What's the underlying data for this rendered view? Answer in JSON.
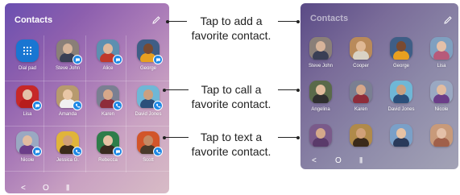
{
  "left_screen": {
    "title": "Contacts",
    "contacts": [
      {
        "name": "Dial pad",
        "type": "dialpad",
        "color": "#1976d2"
      },
      {
        "name": "Steve John",
        "badge": "chat",
        "bg": "#8a7f78",
        "skin": "#d7b49a",
        "shirt": "#3a3f55"
      },
      {
        "name": "Alice",
        "badge": "chat",
        "bg": "#5d8fb0",
        "skin": "#e0b89c",
        "shirt": "#c0392b"
      },
      {
        "name": "George",
        "badge": "chat",
        "bg": "#3f5e86",
        "skin": "#7a4a30",
        "shirt": "#e8a020"
      },
      {
        "name": "Lisa",
        "badge": "chat",
        "bg": "#c62828",
        "skin": "#e4c0a8",
        "shirt": "#b71c1c"
      },
      {
        "name": "Amanda",
        "badge": "phone",
        "bg": "#b79a6e",
        "skin": "#e8c6a6",
        "shirt": "#f1f1f1"
      },
      {
        "name": "Karen",
        "badge": "phone",
        "bg": "#7a7f92",
        "skin": "#d6a88a",
        "shirt": "#8e2c3a"
      },
      {
        "name": "David Jones",
        "badge": "phone",
        "bg": "#6fb7d6",
        "skin": "#caa080",
        "shirt": "#2b4f7a"
      },
      {
        "name": "Nicole",
        "badge": "chat",
        "bg": "#9aa8c2",
        "skin": "#e2bca0",
        "shirt": "#6b3d88"
      },
      {
        "name": "Jessica G.",
        "badge": "phone",
        "bg": "#e0b43a",
        "skin": "#d0a078",
        "shirt": "#3b2a1a"
      },
      {
        "name": "Rebecca",
        "badge": "chat",
        "bg": "#2e7d4a",
        "skin": "#e6c2a4",
        "shirt": "#3a2a20"
      },
      {
        "name": "Scott",
        "badge": "phone",
        "bg": "#d2552a",
        "skin": "#c48a64",
        "shirt": "#4a3a2a"
      }
    ],
    "nav": {
      "back": "<",
      "home": "O",
      "recents": "|||"
    }
  },
  "right_screen": {
    "title": "Contacts",
    "contacts": [
      {
        "name": "Steve John",
        "bg": "#8a7f78",
        "skin": "#d7b49a",
        "shirt": "#3a3f55"
      },
      {
        "name": "Cooper",
        "bg": "#b98a5a",
        "skin": "#e0b894",
        "shirt": "#d9d2c4"
      },
      {
        "name": "George",
        "bg": "#3f5e86",
        "skin": "#7a4a30",
        "shirt": "#e8a020"
      },
      {
        "name": "Lisa",
        "bg": "#7fa0c0",
        "skin": "#e4c0a8",
        "shirt": "#b75a7a"
      },
      {
        "name": "Angelina",
        "bg": "#5a6a4a",
        "skin": "#e2bc9c",
        "shirt": "#2f2f2f"
      },
      {
        "name": "Karen",
        "bg": "#7a7f92",
        "skin": "#d6a88a",
        "shirt": "#8e2c3a"
      },
      {
        "name": "David Jones",
        "bg": "#6fb7d6",
        "skin": "#caa080",
        "shirt": "#2b4f7a"
      },
      {
        "name": "Nicole",
        "bg": "#9aa8c2",
        "skin": "#e2bca0",
        "shirt": "#6b3d88"
      },
      {
        "name": "",
        "bg": "#7a5a8a",
        "skin": "#d4a88a",
        "shirt": "#5a3a6a"
      },
      {
        "name": "",
        "bg": "#b08a4a",
        "skin": "#d0a078",
        "shirt": "#3b2a1a"
      },
      {
        "name": "",
        "bg": "#7aa0c8",
        "skin": "#e6c2a4",
        "shirt": "#2a3a5a"
      },
      {
        "name": "",
        "bg": "#c89a7a",
        "skin": "#e4c0a8",
        "shirt": "#a0604a"
      }
    ],
    "nav": {
      "back": "<",
      "home": "O",
      "recents": "|||"
    }
  },
  "callouts": [
    {
      "line1": "Tap to add a",
      "line2": "favorite contact."
    },
    {
      "line1": "Tap to call a",
      "line2": "favorite contact."
    },
    {
      "line1": "Tap to text a",
      "line2": "favorite contact."
    }
  ]
}
